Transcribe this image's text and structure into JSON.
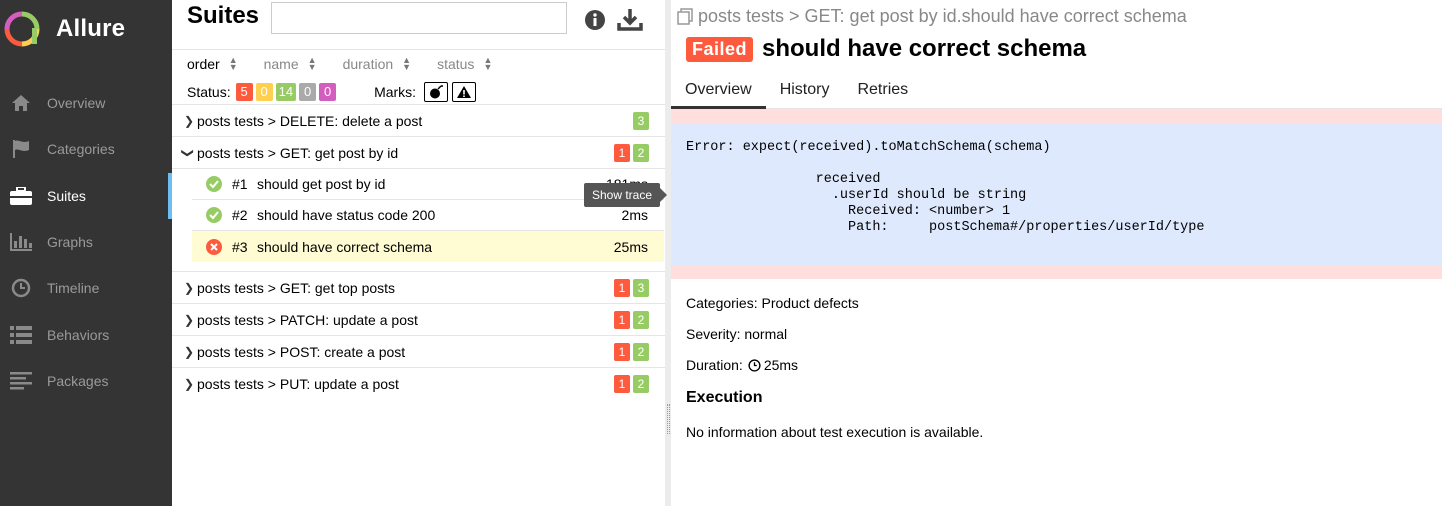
{
  "app": {
    "brand": "Allure"
  },
  "sidebar": {
    "items": [
      {
        "label": "Overview",
        "icon": "home-icon"
      },
      {
        "label": "Categories",
        "icon": "flag-icon"
      },
      {
        "label": "Suites",
        "icon": "briefcase-icon",
        "active": true
      },
      {
        "label": "Graphs",
        "icon": "bar-chart-icon"
      },
      {
        "label": "Timeline",
        "icon": "clock-icon"
      },
      {
        "label": "Behaviors",
        "icon": "list-icon"
      },
      {
        "label": "Packages",
        "icon": "align-left-icon"
      }
    ]
  },
  "suites": {
    "title": "Suites",
    "search_value": "",
    "sort": [
      "order",
      "name",
      "duration",
      "status"
    ],
    "status_label": "Status:",
    "status_counts": {
      "failed": "5",
      "broken": "0",
      "passed": "14",
      "skipped": "0",
      "unknown": "0"
    },
    "marks_label": "Marks:",
    "groups": [
      {
        "label": "posts tests > DELETE: delete a post",
        "failed": "",
        "passed": "3",
        "expanded": false
      },
      {
        "label": "posts tests > GET: get post by id",
        "failed": "1",
        "passed": "2",
        "expanded": true
      },
      {
        "label": "posts tests > GET: get top posts",
        "failed": "1",
        "passed": "3",
        "expanded": false
      },
      {
        "label": "posts tests > PATCH: update a post",
        "failed": "1",
        "passed": "2",
        "expanded": false
      },
      {
        "label": "posts tests > POST: create a post",
        "failed": "1",
        "passed": "2",
        "expanded": false
      },
      {
        "label": "posts tests > PUT: update a post",
        "failed": "1",
        "passed": "2",
        "expanded": false
      }
    ],
    "tests": [
      {
        "order": "#1",
        "name": "should get post by id",
        "duration": "181ms",
        "status": "passed"
      },
      {
        "order": "#2",
        "name": "should have status code 200",
        "duration": "2ms",
        "status": "passed"
      },
      {
        "order": "#3",
        "name": "should have correct schema",
        "duration": "25ms",
        "status": "failed"
      }
    ],
    "tooltip": "Show trace"
  },
  "detail": {
    "breadcrumb": "posts tests > GET: get post by id.should have correct schema",
    "status_badge": "Failed",
    "title": "should have correct schema",
    "tabs": [
      "Overview",
      "History",
      "Retries"
    ],
    "error_text": "Error: expect(received).toMatchSchema(schema)\n\n                received\n                  .userId should be string\n                    Received: <number> 1\n                    Path:     postSchema#/properties/userId/type",
    "categories": "Categories: Product defects",
    "severity": "Severity: normal",
    "duration_label": "Duration:",
    "duration_value": "25ms",
    "execution_title": "Execution",
    "execution_text": "No information about test execution is available."
  },
  "colors": {
    "failed": "#fd5a3e",
    "broken": "#ffd050",
    "passed": "#97cc64",
    "skipped": "#aaaaaa",
    "unknown": "#d35ebe",
    "sidebar": "#343434",
    "accent": "#6ebdf0"
  }
}
